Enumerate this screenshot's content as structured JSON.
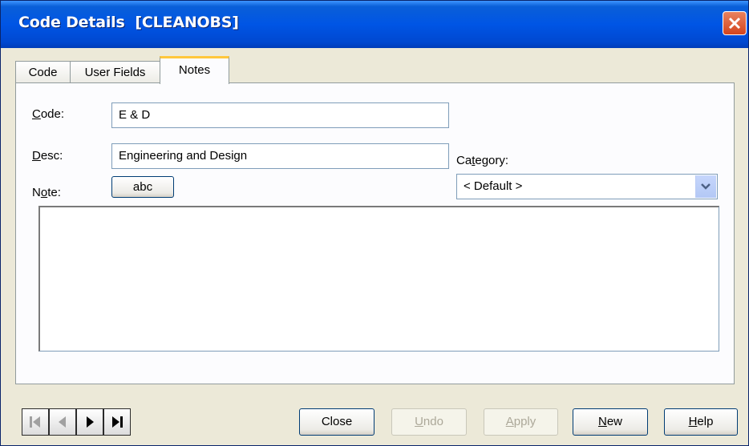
{
  "window": {
    "title": "Code Details  [CLEANOBS]"
  },
  "tabs": [
    {
      "label": "Code",
      "active": false
    },
    {
      "label": "User Fields",
      "active": false
    },
    {
      "label": "Notes",
      "active": true
    }
  ],
  "form": {
    "code": {
      "label_mnemonic": "C",
      "label_rest": "ode:",
      "value": "E & D"
    },
    "desc": {
      "label_mnemonic": "D",
      "label_rest": "esc:",
      "value": "Engineering and Design"
    },
    "note": {
      "label_pre": "N",
      "label_mnemonic": "o",
      "label_rest": "te:",
      "spell_button": "abc",
      "value": ""
    },
    "category": {
      "label_pre": "Ca",
      "label_mnemonic": "t",
      "label_rest": "egory:",
      "selected": "< Default >"
    }
  },
  "buttons": {
    "close": {
      "label": "Close"
    },
    "undo": {
      "mnemonic": "U",
      "rest": "ndo",
      "enabled": false
    },
    "apply": {
      "mnemonic": "A",
      "rest": "pply",
      "enabled": false
    },
    "new": {
      "mnemonic": "N",
      "rest": "ew",
      "enabled": true
    },
    "help": {
      "mnemonic": "H",
      "rest": "elp",
      "enabled": true
    }
  },
  "navigation": [
    "first-record-icon",
    "previous-record-icon",
    "next-record-icon",
    "last-record-icon"
  ],
  "colors": {
    "titlebar": "#0055e5",
    "tab_active_accent": "#ffc73c",
    "close_button": "#d4441c"
  }
}
